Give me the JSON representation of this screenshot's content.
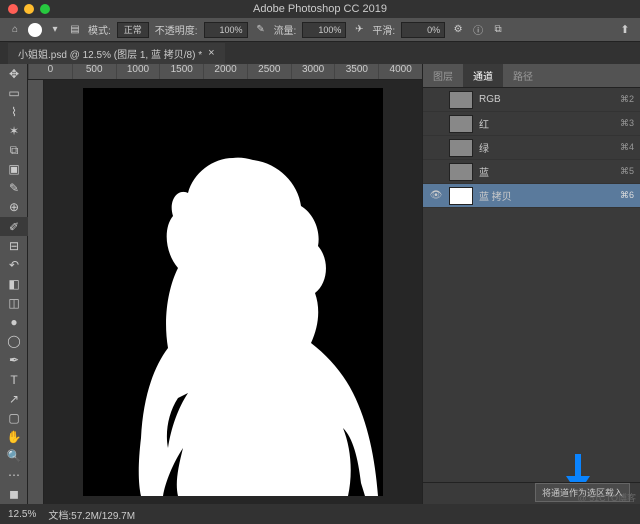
{
  "app_title": "Adobe Photoshop CC 2019",
  "options": {
    "mode_label": "模式:",
    "mode_value": "正常",
    "opacity_label": "不透明度:",
    "opacity_value": "100%",
    "flow_label": "流量:",
    "flow_value": "100%",
    "smooth_label": "平滑:",
    "smooth_value": "0%"
  },
  "doc_tab": "小姐姐.psd @ 12.5% (图层 1, 蓝 拷贝/8) *",
  "rulers": [
    "0",
    "500",
    "1000",
    "1500",
    "2000",
    "2500",
    "3000",
    "3500",
    "4000"
  ],
  "panel_tabs": [
    "图层",
    "通道",
    "路径"
  ],
  "channels": [
    {
      "name": "RGB",
      "key": "⌘2",
      "eye": ""
    },
    {
      "name": "红",
      "key": "⌘3",
      "eye": ""
    },
    {
      "name": "绿",
      "key": "⌘4",
      "eye": ""
    },
    {
      "name": "蓝",
      "key": "⌘5",
      "eye": ""
    },
    {
      "name": "蓝 拷贝",
      "key": "⌘6",
      "eye": "👁",
      "selected": true
    }
  ],
  "tooltip": "将通道作为选区载入",
  "status": {
    "zoom": "12.5%",
    "doc": "文档:57.2M/129.7M"
  },
  "watermark": "@ 51CTO博客"
}
